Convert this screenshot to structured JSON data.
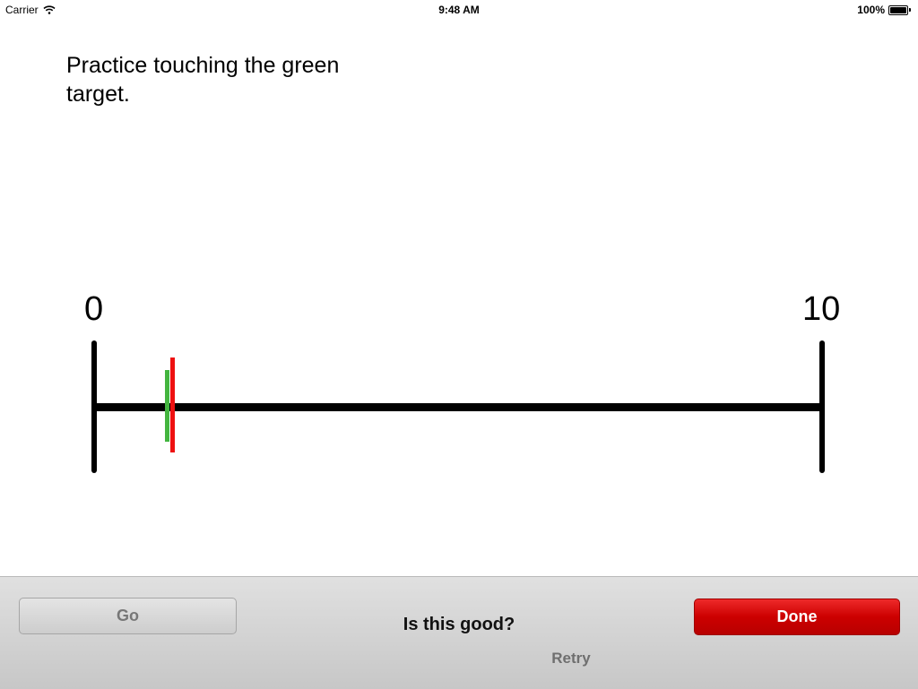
{
  "status_bar": {
    "carrier": "Carrier",
    "time": "9:48 AM",
    "battery": "100%",
    "icons": [
      "wifi-icon",
      "battery-icon"
    ]
  },
  "instruction": "Practice touching the green target.",
  "scale": {
    "min_label": "0",
    "max_label": "10",
    "min_value": 0,
    "max_value": 10,
    "target_value": 1.0,
    "touch_value": 1.08,
    "colors": {
      "target": "#43b53f",
      "touch": "#ee1111",
      "line": "#000000"
    }
  },
  "toolbar": {
    "go_label": "Go",
    "prompt": "Is this good?",
    "done_label": "Done",
    "retry_label": "Retry",
    "colors": {
      "done": "#cc0000",
      "go_text": "#777777"
    }
  }
}
